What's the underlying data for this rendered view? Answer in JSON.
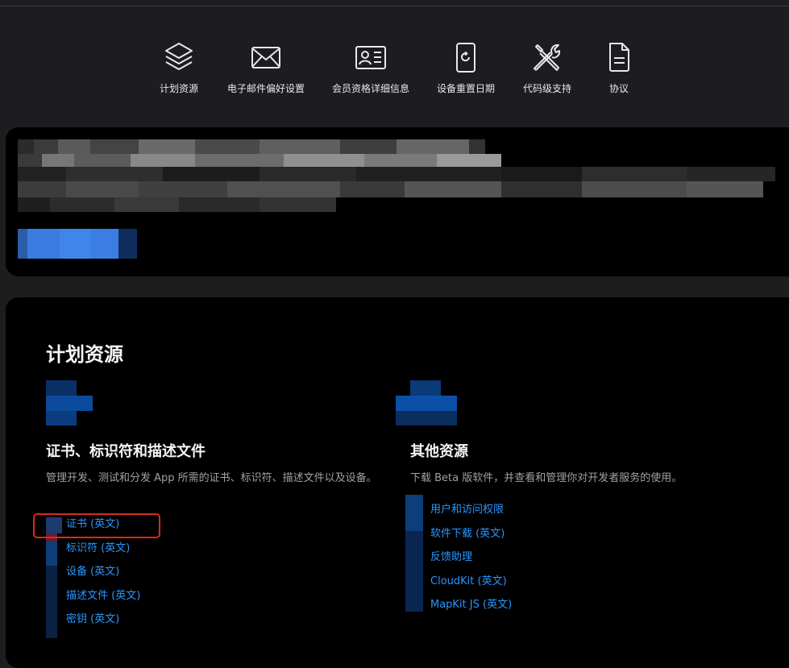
{
  "nav": {
    "items": [
      {
        "label": "计划资源",
        "icon": "layers-icon"
      },
      {
        "label": "电子邮件偏好设置",
        "icon": "envelope-icon"
      },
      {
        "label": "会员资格详细信息",
        "icon": "id-card-icon"
      },
      {
        "label": "设备重置日期",
        "icon": "device-refresh-icon"
      },
      {
        "label": "代码级支持",
        "icon": "tools-icon"
      },
      {
        "label": "协议",
        "icon": "document-icon"
      }
    ]
  },
  "resources": {
    "title": "计划资源",
    "certs": {
      "heading": "证书、标识符和描述文件",
      "description": "管理开发、测试和分发 App 所需的证书、标识符、描述文件以及设备。",
      "links": [
        "证书 (英文)",
        "标识符 (英文)",
        "设备 (英文)",
        "描述文件 (英文)",
        "密钥 (英文)"
      ]
    },
    "other": {
      "heading": "其他资源",
      "description": "下载 Beta 版软件，并查看和管理你对开发者服务的使用。",
      "links": [
        "用户和访问权限",
        "软件下载 (英文)",
        "反馈助理",
        "CloudKit (英文)",
        "MapKit JS (英文)"
      ]
    }
  },
  "colors": {
    "background": "#1d1d1f",
    "card": "#000000",
    "link": "#2997ff",
    "highlight": "#e0261c"
  }
}
